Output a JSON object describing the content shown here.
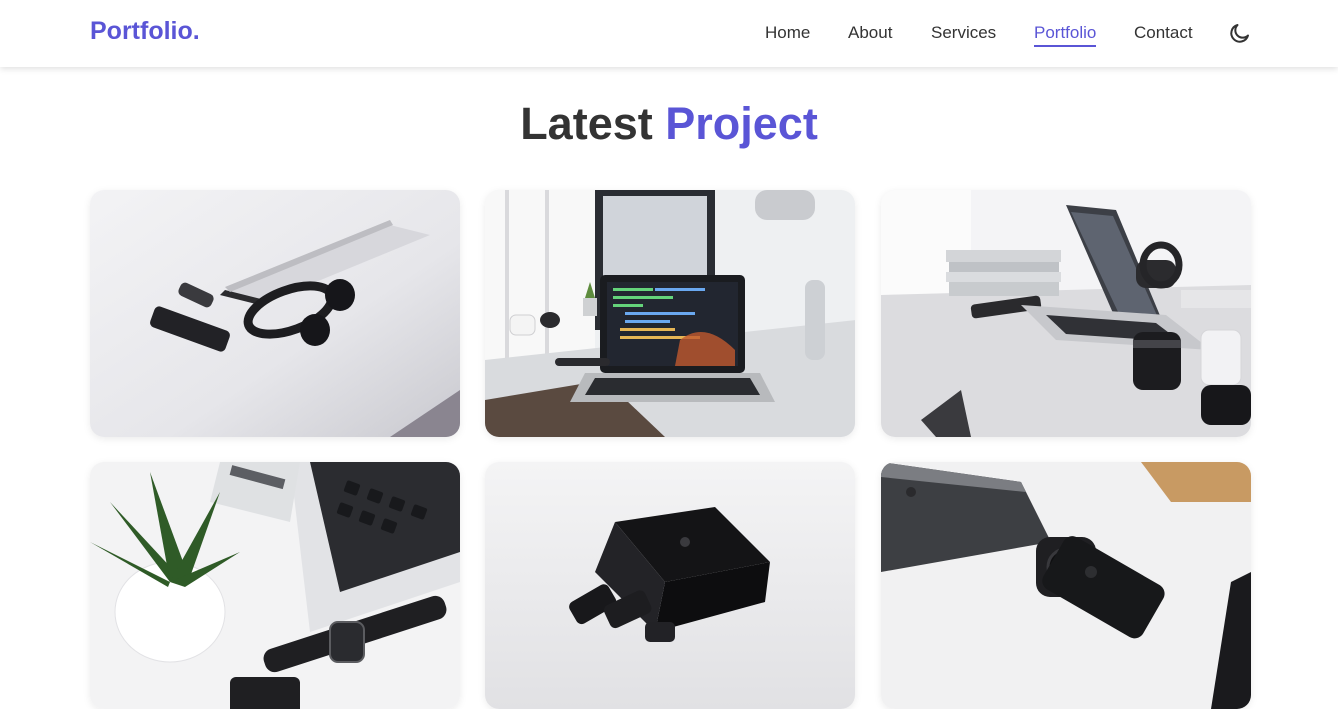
{
  "header": {
    "logo": "Portfolio.",
    "nav": [
      {
        "label": "Home"
      },
      {
        "label": "About"
      },
      {
        "label": "Services"
      },
      {
        "label": "Portfolio",
        "active": true
      },
      {
        "label": "Contact"
      }
    ],
    "theme_icon": "moon-icon"
  },
  "section": {
    "title_main": "Latest",
    "title_accent": "Project"
  },
  "projects": [
    {
      "image": "laptop-headphones-phone-photo"
    },
    {
      "image": "laptop-code-desk-photo"
    },
    {
      "image": "laptop-camera-lens-desk-photo"
    },
    {
      "image": "plant-keyboard-smartwatch-photo"
    },
    {
      "image": "black-laptop-phone-photo"
    },
    {
      "image": "dark-laptop-phone-watch-photo"
    }
  ],
  "colors": {
    "accent": "#5a55d6",
    "text": "#333333",
    "background": "#ffffff"
  }
}
